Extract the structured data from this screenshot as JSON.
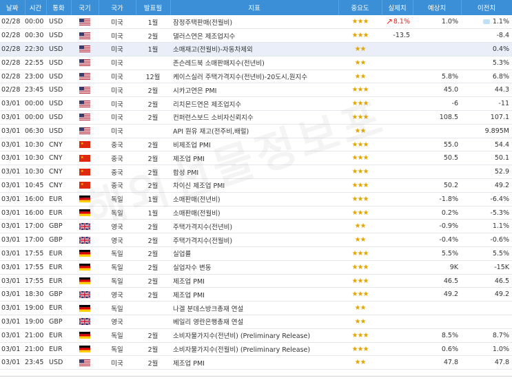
{
  "header": {
    "date": "날짜",
    "time": "시간",
    "currency": "통화",
    "flag": "국기",
    "country": "국가",
    "period": "발표월",
    "indicator": "지표",
    "importance": "중요도",
    "actual": "실제치",
    "forecast": "예상치",
    "previous": "이전치"
  },
  "watermark": "해외선물정보포",
  "rows": [
    {
      "date": "02/28",
      "time": "00:00",
      "currency": "USD",
      "flag": "us",
      "country": "미국",
      "period": "1월",
      "indicator": "잠정주택판매(전월비)",
      "stars": "★★★",
      "actual": "8.1%",
      "actual_color": "red",
      "actual_arrow": "up",
      "forecast": "1.0%",
      "forecast_bubble": true,
      "previous": "1.1%",
      "highlight": false
    },
    {
      "date": "02/28",
      "time": "00:30",
      "currency": "USD",
      "flag": "us",
      "country": "미국",
      "period": "2월",
      "indicator": "댈러스연은 제조업지수",
      "stars": "★★★",
      "actual": "-13.5",
      "forecast": "",
      "previous": "-8.4",
      "highlight": false
    },
    {
      "date": "02/28",
      "time": "22:30",
      "currency": "USD",
      "flag": "us",
      "country": "미국",
      "period": "1월",
      "indicator": "소매재고(전월비)-자동차제외",
      "stars": "★★",
      "actual": "",
      "forecast": "",
      "previous": "0.4%",
      "highlight": true
    },
    {
      "date": "02/28",
      "time": "22:55",
      "currency": "USD",
      "flag": "us",
      "country": "미국",
      "period": "",
      "indicator": "존슨레드북 소매판매지수(전년비)",
      "stars": "★★",
      "actual": "",
      "forecast": "",
      "previous": "5.3%",
      "highlight": false
    },
    {
      "date": "02/28",
      "time": "23:00",
      "currency": "USD",
      "flag": "us",
      "country": "미국",
      "period": "12월",
      "indicator": "케이스실러 주택가격지수(전년비)-20도시,원지수",
      "stars": "★★",
      "actual": "",
      "forecast": "5.8%",
      "previous": "6.8%",
      "highlight": false
    },
    {
      "date": "02/28",
      "time": "23:45",
      "currency": "USD",
      "flag": "us",
      "country": "미국",
      "period": "2월",
      "indicator": "시카고연은 PMI",
      "stars": "★★★",
      "actual": "",
      "forecast": "45.0",
      "previous": "44.3",
      "highlight": false
    },
    {
      "date": "03/01",
      "time": "00:00",
      "currency": "USD",
      "flag": "us",
      "country": "미국",
      "period": "2월",
      "indicator": "리치몬드연은 제조업지수",
      "stars": "★★★",
      "actual": "",
      "forecast": "-6",
      "previous": "-11",
      "highlight": false
    },
    {
      "date": "03/01",
      "time": "00:00",
      "currency": "USD",
      "flag": "us",
      "country": "미국",
      "period": "2월",
      "indicator": "컨퍼런스보드 소비자신뢰지수",
      "stars": "★★★",
      "actual": "",
      "forecast": "108.5",
      "previous": "107.1",
      "highlight": false
    },
    {
      "date": "03/01",
      "time": "06:30",
      "currency": "USD",
      "flag": "us",
      "country": "미국",
      "period": "",
      "indicator": "API 원유 재고(전주비,배럴)",
      "stars": "★★",
      "actual": "",
      "forecast": "",
      "previous": "9.895M",
      "highlight": false
    },
    {
      "date": "03/01",
      "time": "10:30",
      "currency": "CNY",
      "flag": "cn",
      "country": "중국",
      "period": "2월",
      "indicator": "비제조업 PMI",
      "stars": "★★★",
      "actual": "",
      "forecast": "55.0",
      "previous": "54.4",
      "highlight": false
    },
    {
      "date": "03/01",
      "time": "10:30",
      "currency": "CNY",
      "flag": "cn",
      "country": "중국",
      "period": "2월",
      "indicator": "제조업 PMI",
      "stars": "★★★",
      "actual": "",
      "forecast": "50.5",
      "previous": "50.1",
      "highlight": false
    },
    {
      "date": "03/01",
      "time": "10:30",
      "currency": "CNY",
      "flag": "cn",
      "country": "중국",
      "period": "2월",
      "indicator": "합성 PMI",
      "stars": "★★★",
      "actual": "",
      "forecast": "",
      "previous": "52.9",
      "highlight": false
    },
    {
      "date": "03/01",
      "time": "10:45",
      "currency": "CNY",
      "flag": "cn",
      "country": "중국",
      "period": "2월",
      "indicator": "차이신 제조업 PMI",
      "stars": "★★★",
      "actual": "",
      "forecast": "50.2",
      "previous": "49.2",
      "highlight": false
    },
    {
      "date": "03/01",
      "time": "16:00",
      "currency": "EUR",
      "flag": "de",
      "country": "독일",
      "period": "1월",
      "indicator": "소매판매(전년비)",
      "stars": "★★★",
      "actual": "",
      "forecast": "-1.8%",
      "previous": "-6.4%",
      "highlight": false
    },
    {
      "date": "03/01",
      "time": "16:00",
      "currency": "EUR",
      "flag": "de",
      "country": "독일",
      "period": "1월",
      "indicator": "소매판매(전월비)",
      "stars": "★★★",
      "actual": "",
      "forecast": "0.2%",
      "previous": "-5.3%",
      "highlight": false
    },
    {
      "date": "03/01",
      "time": "17:00",
      "currency": "GBP",
      "flag": "gb",
      "country": "영국",
      "period": "2월",
      "indicator": "주택가격지수(전년비)",
      "stars": "★★",
      "actual": "",
      "forecast": "-0.9%",
      "previous": "1.1%",
      "highlight": false
    },
    {
      "date": "03/01",
      "time": "17:00",
      "currency": "GBP",
      "flag": "gb",
      "country": "영국",
      "period": "2월",
      "indicator": "주택가격지수(전월비)",
      "stars": "★★",
      "actual": "",
      "forecast": "-0.4%",
      "previous": "-0.6%",
      "highlight": false
    },
    {
      "date": "03/01",
      "time": "17:55",
      "currency": "EUR",
      "flag": "de",
      "country": "독일",
      "period": "2월",
      "indicator": "실업률",
      "stars": "★★★",
      "actual": "",
      "forecast": "5.5%",
      "previous": "5.5%",
      "highlight": false
    },
    {
      "date": "03/01",
      "time": "17:55",
      "currency": "EUR",
      "flag": "de",
      "country": "독일",
      "period": "2월",
      "indicator": "실업자수 변동",
      "stars": "★★★",
      "actual": "",
      "forecast": "9K",
      "previous": "-15K",
      "highlight": false
    },
    {
      "date": "03/01",
      "time": "17:55",
      "currency": "EUR",
      "flag": "de",
      "country": "독일",
      "period": "2월",
      "indicator": "제조업 PMI",
      "stars": "★★★",
      "actual": "",
      "forecast": "46.5",
      "previous": "46.5",
      "highlight": false
    },
    {
      "date": "03/01",
      "time": "18:30",
      "currency": "GBP",
      "flag": "gb",
      "country": "영국",
      "period": "2월",
      "indicator": "제조업 PMI",
      "stars": "★★★",
      "actual": "",
      "forecast": "49.2",
      "previous": "49.2",
      "highlight": false
    },
    {
      "date": "03/01",
      "time": "19:00",
      "currency": "EUR",
      "flag": "de",
      "country": "독일",
      "period": "",
      "indicator": "나겔 분데스방크총재 연설",
      "stars": "★★",
      "actual": "",
      "forecast": "",
      "previous": "",
      "highlight": false
    },
    {
      "date": "03/01",
      "time": "19:00",
      "currency": "GBP",
      "flag": "gb",
      "country": "영국",
      "period": "",
      "indicator": "베일리 영란은행총재 연설",
      "stars": "★★",
      "actual": "",
      "forecast": "",
      "previous": "",
      "highlight": false
    },
    {
      "date": "03/01",
      "time": "21:00",
      "currency": "EUR",
      "flag": "de",
      "country": "독일",
      "period": "2월",
      "indicator": "소비자물가지수(전년비) (Preliminary Release)",
      "stars": "★★★",
      "actual": "",
      "forecast": "8.5%",
      "previous": "8.7%",
      "highlight": false
    },
    {
      "date": "03/01",
      "time": "21:00",
      "currency": "EUR",
      "flag": "de",
      "country": "독일",
      "period": "2월",
      "indicator": "소비자물가지수(전월비) (Preliminary Release)",
      "stars": "★★★",
      "actual": "",
      "forecast": "0.6%",
      "previous": "1.0%",
      "highlight": false
    },
    {
      "date": "03/01",
      "time": "23:45",
      "currency": "USD",
      "flag": "us",
      "country": "미국",
      "period": "2월",
      "indicator": "제조업 PMI",
      "stars": "★★",
      "actual": "",
      "forecast": "47.8",
      "previous": "47.8",
      "highlight": false
    }
  ]
}
